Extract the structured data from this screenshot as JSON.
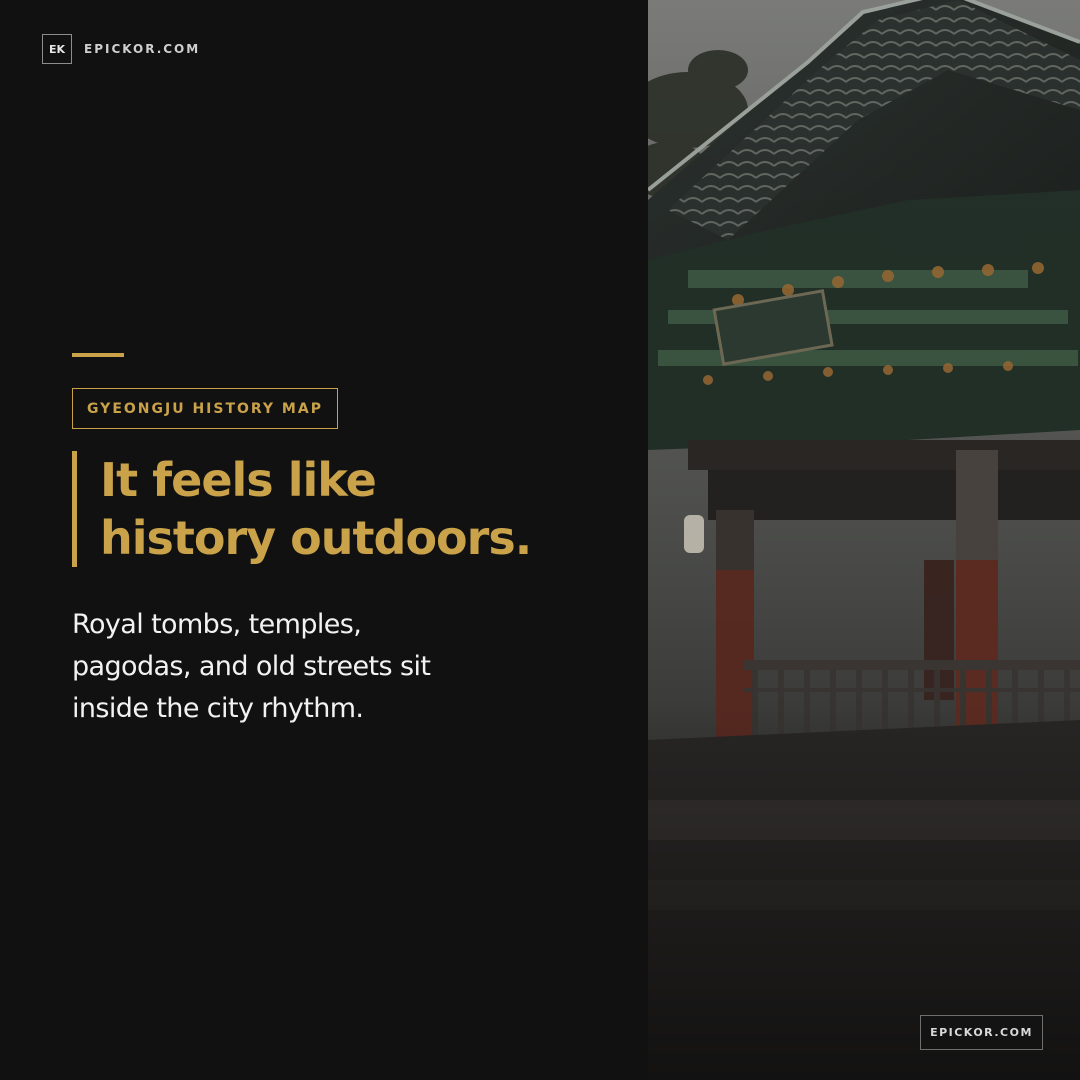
{
  "brand": {
    "mark": "EK",
    "name": "EPICKOR.COM"
  },
  "tag": {
    "label": "GYEONGJU HISTORY MAP"
  },
  "headline": {
    "line1": "It feels like",
    "line2": "history outdoors."
  },
  "body": {
    "line1": "Royal tombs, temples,",
    "line2": "pagodas, and old streets sit",
    "line3": "inside the city rhythm."
  },
  "photo": {
    "subject": "traditional-korean-pavilion-photo"
  },
  "watermark": {
    "text": "EPICKOR.COM"
  },
  "colors": {
    "background": "#111112",
    "accent": "#c9a24a",
    "body_text": "#f2f2f2"
  }
}
